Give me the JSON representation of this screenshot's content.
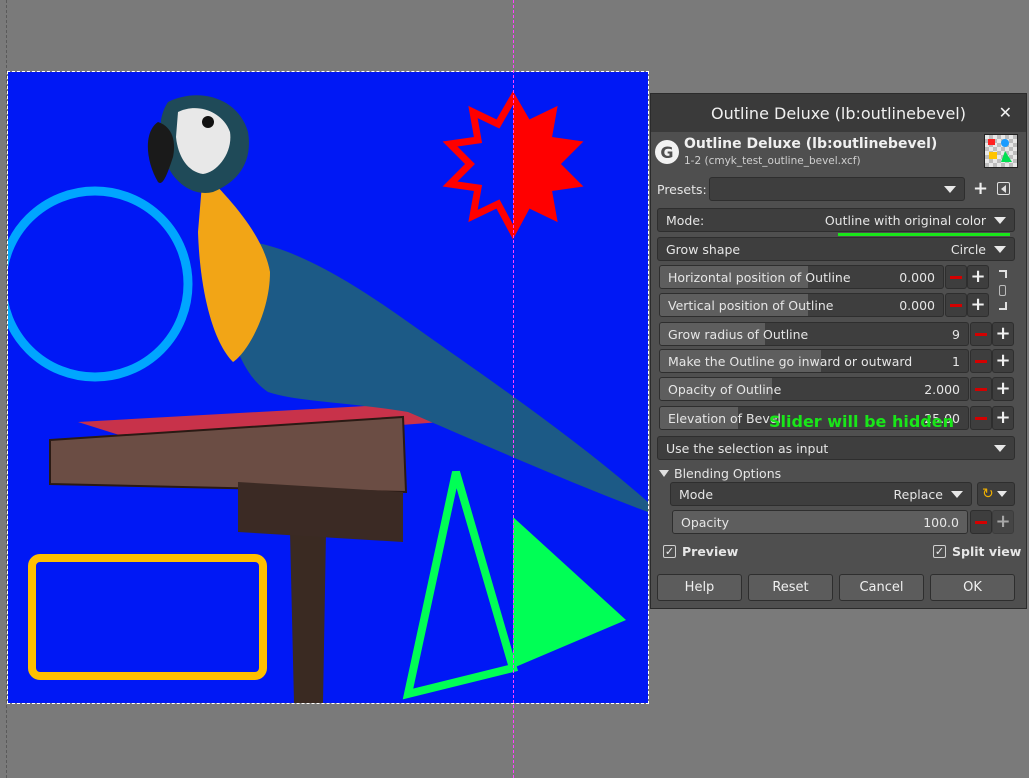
{
  "dialog": {
    "window_title": "Outline Deluxe (lb:outlinebevel)",
    "close_glyph": "✕",
    "header_title": "Outline Deluxe (lb:outlinebevel)",
    "header_subtitle": "1-2 (cmyk_test_outline_bevel.xcf)",
    "logo_letter": "G",
    "presets_label": "Presets:",
    "presets_value": "",
    "mode_label": "Mode:",
    "mode_value": "Outline with original color",
    "grow_shape_label": "Grow shape",
    "grow_shape_value": "Circle",
    "sliders": [
      {
        "label": "Horizontal position of Outline",
        "value": "0.000",
        "fraction": 0.52
      },
      {
        "label": "Vertical position of Outline",
        "value": "0.000",
        "fraction": 0.52
      },
      {
        "label": "Grow radius of Outline",
        "value": "9",
        "fraction": 0.34
      },
      {
        "label": "Make the Outline go inward or outward",
        "value": "1",
        "fraction": 0.52
      },
      {
        "label": "Opacity of Outline",
        "value": "2.000",
        "fraction": 0.36
      },
      {
        "label": "Elevation of Bevel",
        "value": "25.00",
        "fraction": 0.25
      }
    ],
    "overlay_note": "Slider will be hidden",
    "selection_input": "Use the selection as input",
    "blending_header": "Blending Options",
    "blend_mode_label": "Mode",
    "blend_mode_value": "Replace",
    "blend_opacity_label": "Opacity",
    "blend_opacity_value": "100.0",
    "preview_label": "Preview",
    "split_view_label": "Split view",
    "buttons": {
      "help": "Help",
      "reset": "Reset",
      "cancel": "Cancel",
      "ok": "OK"
    },
    "icons": [
      "close-icon",
      "gimp-logo-icon",
      "plus-icon",
      "save-preset-icon",
      "chain-link-icon",
      "minus-icon",
      "reset-icon",
      "checkbox-icon",
      "dropdown-arrow-icon"
    ]
  },
  "colors": {
    "canvas_bg": "#0018f5",
    "guide": "#ff40ff",
    "note_green": "#19e619",
    "minus_red": "#d40000"
  }
}
